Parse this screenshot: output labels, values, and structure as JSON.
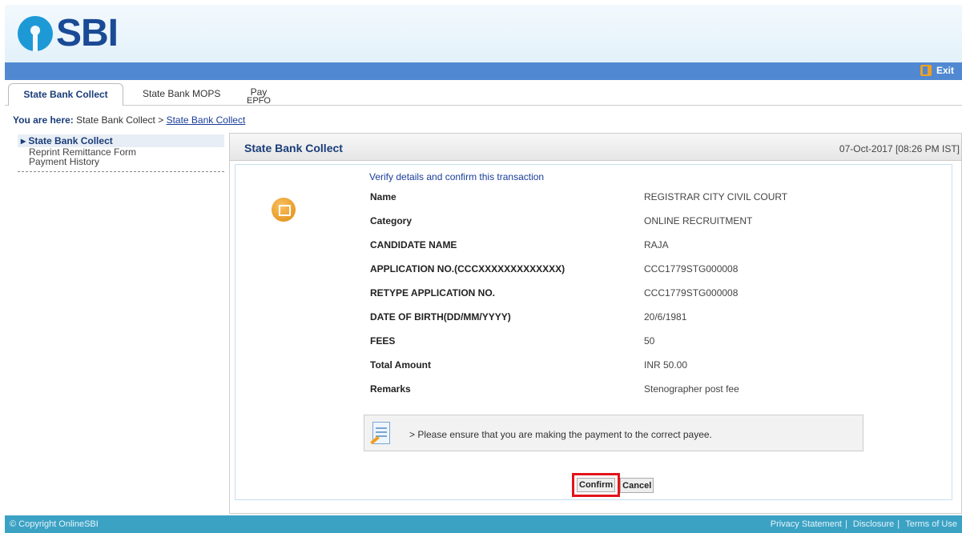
{
  "brand": {
    "logo_text": "SBI",
    "logo_icon": "sbi-logo-icon"
  },
  "topbar": {
    "exit_label": "Exit",
    "exit_icon": "exit-icon"
  },
  "tabs": [
    {
      "label": "State Bank Collect",
      "active": true
    },
    {
      "label": "State Bank MOPS"
    },
    {
      "label_line1": "Pay",
      "label_line2": "EPFO"
    }
  ],
  "breadcrumb": {
    "label": "You are here:",
    "path_text": "State Bank Collect >",
    "link": "State Bank Collect"
  },
  "sidenav": {
    "items": [
      {
        "label": "State Bank Collect",
        "active": true
      },
      {
        "label": "Reprint Remittance Form"
      },
      {
        "label": "Payment History"
      }
    ]
  },
  "panel": {
    "title": "State Bank Collect",
    "datetime": "07-Oct-2017 [08:26 PM IST]",
    "verify_heading": "Verify details and confirm this transaction",
    "fields": [
      {
        "label": "Name",
        "value": "REGISTRAR CITY CIVIL COURT"
      },
      {
        "label": "Category",
        "value": "ONLINE RECRUITMENT"
      },
      {
        "label": "CANDIDATE NAME",
        "value": "RAJA"
      },
      {
        "label": "APPLICATION NO.(CCCXXXXXXXXXXXXX)",
        "value": "CCC1779STG000008"
      },
      {
        "label": "RETYPE APPLICATION NO.",
        "value": "CCC1779STG000008"
      },
      {
        "label": "DATE OF BIRTH(DD/MM/YYYY)",
        "value": "20/6/1981"
      },
      {
        "label": "FEES",
        "value": "50"
      },
      {
        "label": "Total Amount",
        "value": "INR 50.00"
      },
      {
        "label": "Remarks",
        "value": "Stenographer post fee"
      }
    ],
    "notice": "> Please ensure that you are making the payment to the correct payee.",
    "confirm_label": "Confirm",
    "cancel_label": "Cancel"
  },
  "footer": {
    "copyright": "© Copyright OnlineSBI",
    "links": [
      "Privacy Statement",
      "Disclosure",
      "Terms of Use"
    ]
  },
  "colors": {
    "brand_blue": "#1a4a96",
    "bar_blue": "#5089d1",
    "footer": "#3ca2c4",
    "highlight_red": "#e3141b"
  }
}
